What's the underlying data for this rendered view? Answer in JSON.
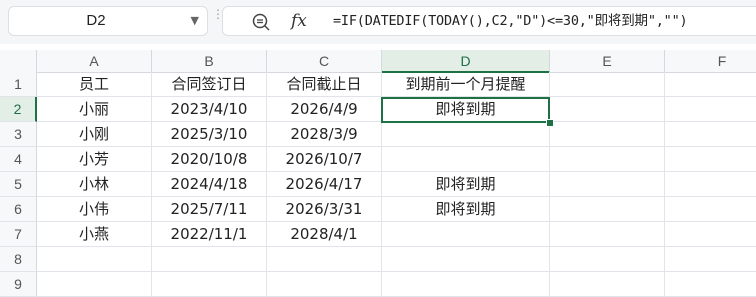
{
  "name_box": {
    "value": "D2"
  },
  "formula": {
    "fx_label": "fx",
    "text": "=IF(DATEDIF(TODAY(),C2,\"D\")<=30,\"即将到期\",\"\")"
  },
  "columns": [
    "A",
    "B",
    "C",
    "D",
    "E",
    "F"
  ],
  "active_column": "D",
  "active_row": "2",
  "rows": [
    {
      "num": "1",
      "cells": [
        "员工",
        "合同签订日",
        "合同截止日",
        "到期前一个月提醒",
        "",
        ""
      ]
    },
    {
      "num": "2",
      "cells": [
        "小丽",
        "2023/4/10",
        "2026/4/9",
        "即将到期",
        "",
        ""
      ]
    },
    {
      "num": "3",
      "cells": [
        "小刚",
        "2025/3/10",
        "2028/3/9",
        "",
        "",
        ""
      ]
    },
    {
      "num": "4",
      "cells": [
        "小芳",
        "2020/10/8",
        "2026/10/7",
        "",
        "",
        ""
      ]
    },
    {
      "num": "5",
      "cells": [
        "小林",
        "2024/4/18",
        "2026/4/17",
        "即将到期",
        "",
        ""
      ]
    },
    {
      "num": "6",
      "cells": [
        "小伟",
        "2025/7/11",
        "2026/3/31",
        "即将到期",
        "",
        ""
      ]
    },
    {
      "num": "7",
      "cells": [
        "小燕",
        "2022/11/1",
        "2028/4/1",
        "",
        "",
        ""
      ]
    },
    {
      "num": "8",
      "cells": [
        "",
        "",
        "",
        "",
        "",
        ""
      ]
    },
    {
      "num": "9",
      "cells": [
        "",
        "",
        "",
        "",
        "",
        ""
      ]
    }
  ],
  "colors": {
    "accent": "#1e7145",
    "grid": "#e1e4e8",
    "header_bg": "#f7f8fa"
  }
}
